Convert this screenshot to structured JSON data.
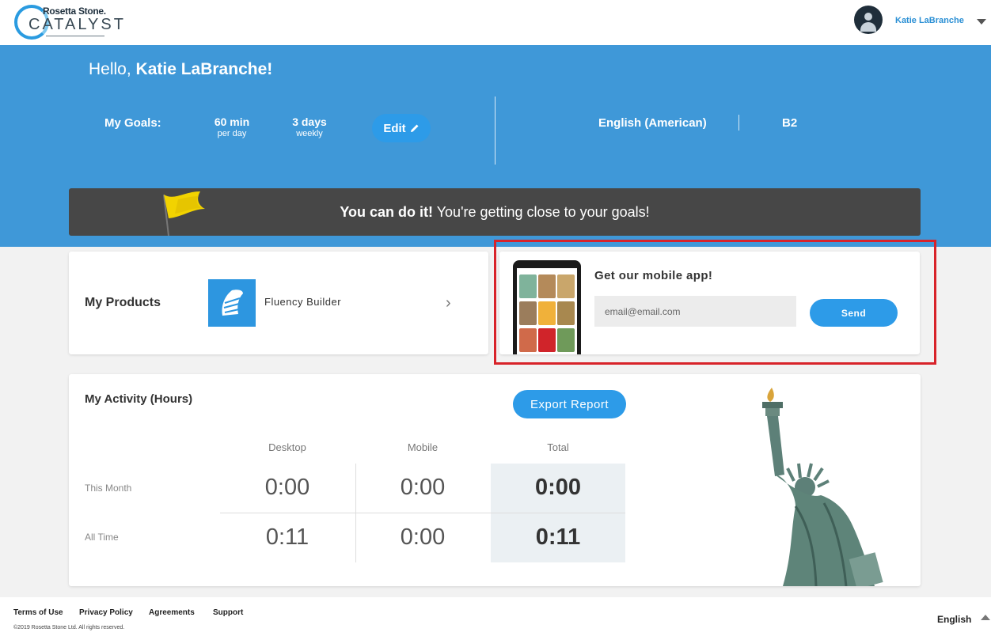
{
  "brand": {
    "line1": "Rosetta Stone.",
    "line2": "CATALYST"
  },
  "user": {
    "name": "Katie LaBranche"
  },
  "hero": {
    "greeting": "Hello, ",
    "name": "Katie LaBranche!",
    "goals_label": "My Goals:",
    "goal_minutes": "60 min",
    "goal_minutes_sub": "per day",
    "goal_days": "3 days",
    "goal_days_sub": "weekly",
    "edit_label": "Edit",
    "language": "English (American)",
    "level": "B2"
  },
  "banner": {
    "bold": "You can do it!",
    "text": " You're getting close to your goals!"
  },
  "products": {
    "title": "My Products",
    "item": "Fluency Builder"
  },
  "mobile": {
    "title": "Get our mobile app!",
    "email_placeholder": "email@email.com",
    "send_label": "Send"
  },
  "activity": {
    "title": "My Activity (Hours)",
    "export_label": "Export Report",
    "columns": [
      "Desktop",
      "Mobile",
      "Total"
    ],
    "rows": [
      {
        "label": "This Month",
        "desktop": "0:00",
        "mobile": "0:00",
        "total": "0:00"
      },
      {
        "label": "All Time",
        "desktop": "0:11",
        "mobile": "0:00",
        "total": "0:11"
      }
    ]
  },
  "footer": {
    "links": [
      "Terms of Use",
      "Privacy Policy",
      "Agreements",
      "Support"
    ],
    "copyright": "©2019 Rosetta Stone Ltd. All rights reserved.",
    "language": "English"
  },
  "colors": {
    "brand_blue": "#3f98d8",
    "button_blue": "#2d9be8",
    "banner_dark": "#474747",
    "highlight_red": "#d8232a"
  }
}
